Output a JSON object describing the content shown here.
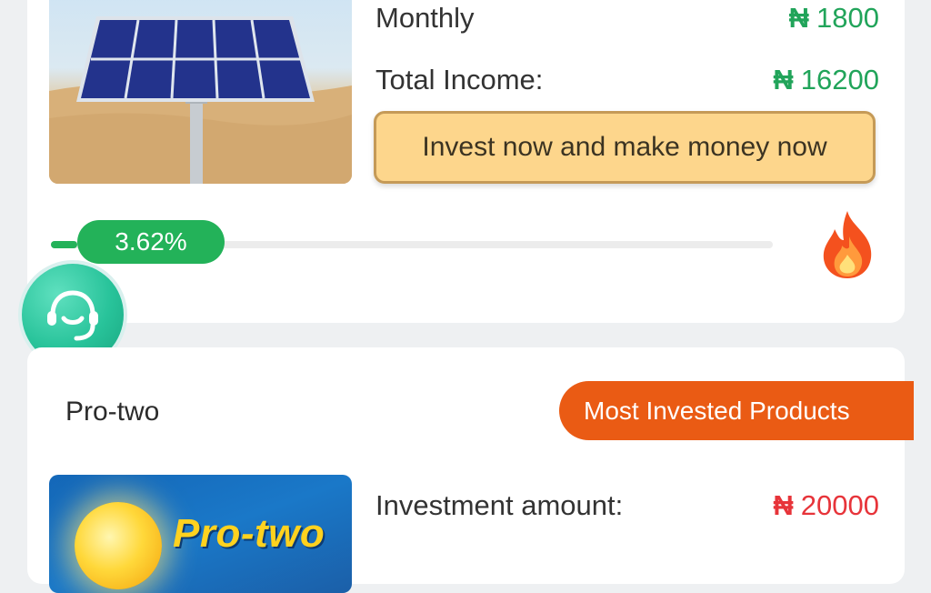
{
  "currency_symbol": "₦",
  "product1": {
    "monthly_label": "Monthly",
    "monthly_value": "1800",
    "total_income_label": "Total Income:",
    "total_income_value": "16200",
    "invest_button": "Invest now and make money now",
    "progress_label": "3.62%",
    "progress_fraction": 0.0362,
    "colors": {
      "value_green": "#21a45a",
      "button_bg": "#fdd68c",
      "progress": "#23b259"
    },
    "icons": {
      "trend": "fire-icon"
    }
  },
  "support": {
    "icon": "headset-icon",
    "color": "#28c39a"
  },
  "product2": {
    "name": "Pro-two",
    "badge": "Most Invested Products",
    "badge_color": "#ea5b14",
    "image_text": "Pro-two",
    "investment_amount_label": "Investment amount:",
    "investment_amount_value": "20000",
    "investment_amount_color": "#e7343a"
  }
}
